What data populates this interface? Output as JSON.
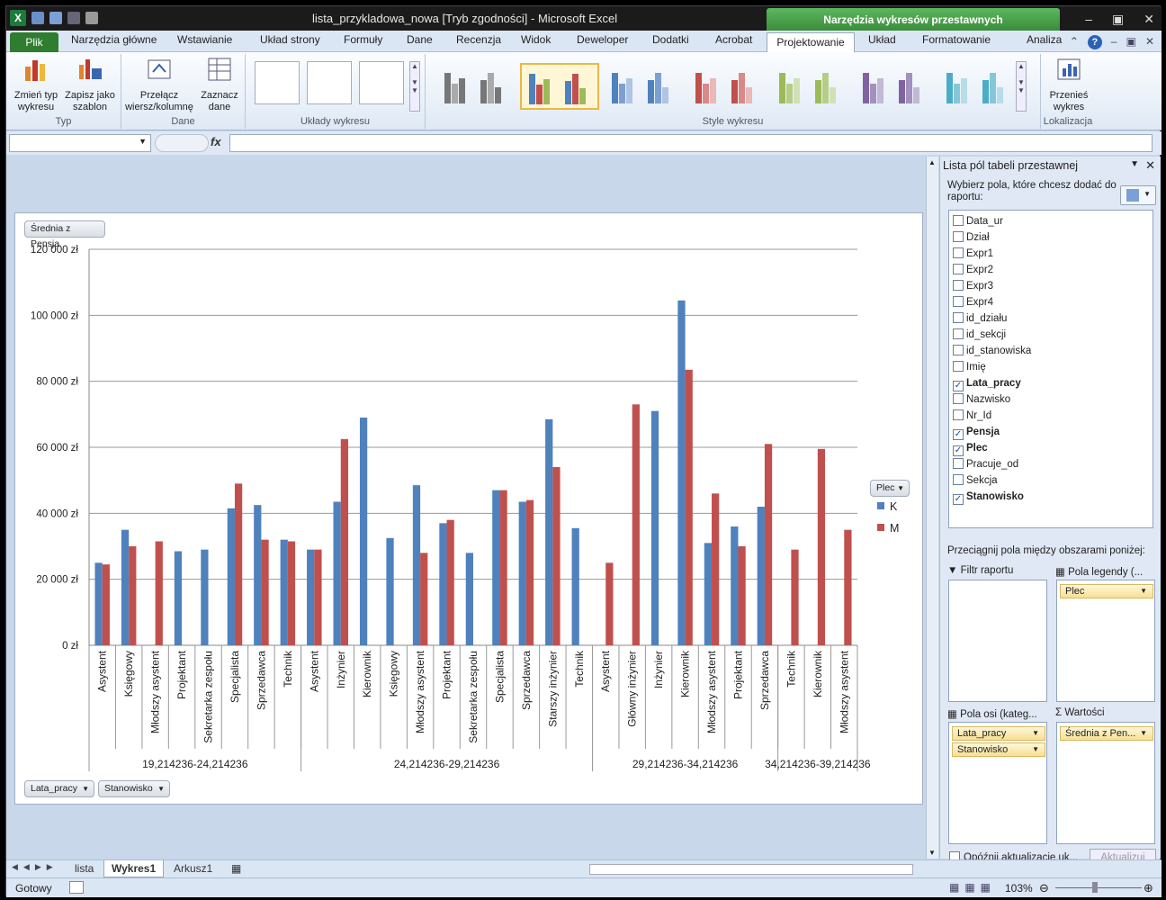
{
  "window": {
    "title": "lista_przykladowa_nowa  [Tryb zgodności]  -  Microsoft Excel",
    "context_tools": "Narzędzia wykresów przestawnych"
  },
  "tabs": {
    "file": "Plik",
    "items": [
      "Narzędzia główne",
      "Wstawianie",
      "Układ strony",
      "Formuły",
      "Dane",
      "Recenzja",
      "Widok",
      "Deweloper",
      "Dodatki",
      "Acrobat"
    ],
    "active": "Projektowanie",
    "context": [
      "Układ",
      "Formatowanie",
      "Analiza"
    ]
  },
  "ribbon": {
    "typ": {
      "label": "Typ",
      "change_type": "Zmień typ wykresu",
      "save_template": "Zapisz jako szablon"
    },
    "dane": {
      "label": "Dane",
      "switch_row_col": "Przełącz wiersz/kolumnę",
      "select_data": "Zaznacz dane"
    },
    "uklady": {
      "label": "Układy wykresu"
    },
    "style": {
      "label": "Style wykresu"
    },
    "lokalizacja": {
      "label": "Lokalizacja",
      "move_chart": "Przenieś wykres"
    },
    "style_colors": [
      [
        "#777777",
        "#aaaaaa"
      ],
      [
        "#4f81bd",
        "#c0504d",
        "#9bbb59"
      ],
      [
        "#4f81bd",
        "#7ea0d1",
        "#b0c4e4"
      ],
      [
        "#c0504d",
        "#d98987",
        "#eab8b7"
      ],
      [
        "#9bbb59",
        "#b6cd87",
        "#d2e1b5"
      ],
      [
        "#8064a2",
        "#a290bd",
        "#c3b8d6"
      ],
      [
        "#4bacc6",
        "#84c7d9",
        "#b7dde9"
      ]
    ]
  },
  "formula": {
    "fx": "fx"
  },
  "chart": {
    "value_button": "Średnia z Pensja",
    "axis_buttons": [
      "Lata_pracy",
      "Stanowisko"
    ],
    "legend_button": "Plec",
    "colors": {
      "K": "#4f81bd",
      "M": "#c0504d"
    }
  },
  "chart_data": {
    "type": "bar",
    "yticks": [
      "0 zł",
      "20 000 zł",
      "40 000 zł",
      "60 000 zł",
      "80 000 zł",
      "100 000 zł",
      "120 000 zł"
    ],
    "ylim": [
      0,
      120000
    ],
    "grid": true,
    "legend_placement": "right",
    "legend": [
      "K",
      "M"
    ],
    "groups": [
      {
        "name": "19,214236-24,214236",
        "categories": [
          "Asystent",
          "Księgowy",
          "Młodszy asystent",
          "Projektant",
          "Sekretarka zespołu",
          "Specjalista",
          "Sprzedawca",
          "Technik"
        ],
        "K": [
          25000,
          35000,
          null,
          28500,
          29000,
          41500,
          42500,
          32000
        ],
        "M": [
          24500,
          30000,
          31500,
          null,
          null,
          49000,
          32000,
          31500
        ]
      },
      {
        "name": "24,214236-29,214236",
        "categories": [
          "Asystent",
          "Inżynier",
          "Kierownik",
          "Księgowy",
          "Młodszy asystent",
          "Projektant",
          "Sekretarka zespołu",
          "Specjalista",
          "Sprzedawca",
          "Starszy inżynier",
          "Technik"
        ],
        "K": [
          29000,
          43500,
          69000,
          32500,
          48500,
          37000,
          28000,
          47000,
          43500,
          68500,
          35500
        ],
        "M": [
          29000,
          62500,
          null,
          null,
          28000,
          38000,
          null,
          47000,
          44000,
          54000,
          null
        ]
      },
      {
        "name": "29,214236-34,214236",
        "categories": [
          "Asystent",
          "Główny inżynier",
          "Inżynier",
          "Kierownik",
          "Młodszy asystent",
          "Projektant",
          "Sprzedawca"
        ],
        "K": [
          null,
          null,
          71000,
          104500,
          31000,
          36000,
          42000
        ],
        "M": [
          25000,
          73000,
          null,
          83500,
          46000,
          30000,
          61000
        ]
      },
      {
        "name": "34,214236-39,214236",
        "categories": [
          "Technik",
          "Kierownik",
          "Młodszy asystent"
        ],
        "K": [
          null,
          null,
          null
        ],
        "M": [
          29000,
          59500,
          35000
        ]
      }
    ]
  },
  "pane": {
    "title": "Lista pól tabeli przestawnej",
    "prompt": "Wybierz pola, które chcesz dodać do raportu:",
    "fields": [
      {
        "name": "Data_ur",
        "checked": false
      },
      {
        "name": "Dział",
        "checked": false
      },
      {
        "name": "Expr1",
        "checked": false
      },
      {
        "name": "Expr2",
        "checked": false
      },
      {
        "name": "Expr3",
        "checked": false
      },
      {
        "name": "Expr4",
        "checked": false
      },
      {
        "name": "id_działu",
        "checked": false
      },
      {
        "name": "id_sekcji",
        "checked": false
      },
      {
        "name": "id_stanowiska",
        "checked": false
      },
      {
        "name": "Imię",
        "checked": false
      },
      {
        "name": "Lata_pracy",
        "checked": true
      },
      {
        "name": "Nazwisko",
        "checked": false
      },
      {
        "name": "Nr_Id",
        "checked": false
      },
      {
        "name": "Pensja",
        "checked": true
      },
      {
        "name": "Plec",
        "checked": true
      },
      {
        "name": "Pracuje_od",
        "checked": false
      },
      {
        "name": "Sekcja",
        "checked": false
      },
      {
        "name": "Stanowisko",
        "checked": true
      }
    ],
    "drag_text": "Przeciągnij pola między obszarami poniżej:",
    "zones": {
      "filter": {
        "label": "Filtr raportu",
        "items": []
      },
      "legend": {
        "label": "Pola legendy (...",
        "items": [
          "Plec"
        ]
      },
      "axis": {
        "label": "Pola osi (kateg...",
        "items": [
          "Lata_pracy",
          "Stanowisko"
        ]
      },
      "values": {
        "label": "Wartości",
        "items": [
          "Średnia z Pen..."
        ]
      }
    },
    "defer": "Opóźnij aktualizację uk...",
    "update": "Aktualizuj"
  },
  "sheets": {
    "tabs": [
      "lista",
      "Wykres1",
      "Arkusz1"
    ],
    "active": "Wykres1"
  },
  "status": {
    "ready": "Gotowy",
    "zoom": "103%"
  }
}
